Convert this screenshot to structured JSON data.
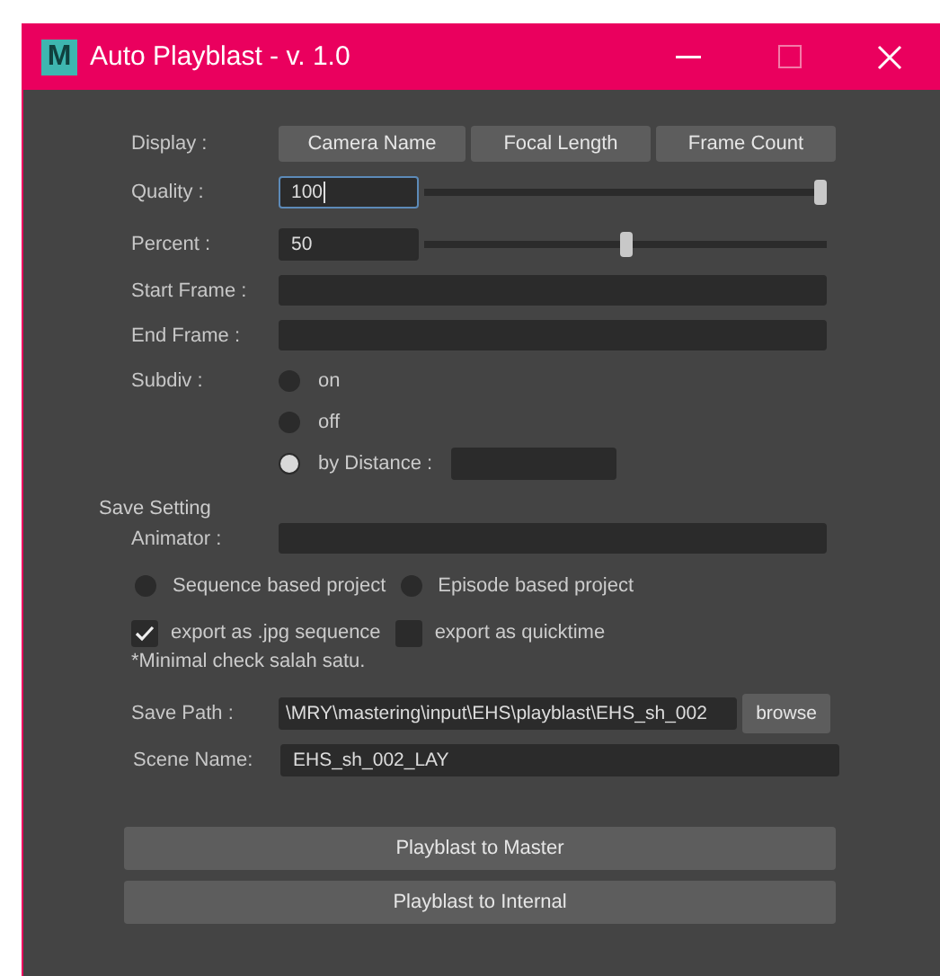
{
  "window": {
    "title": "Auto Playblast - v. 1.0",
    "logo": "M"
  },
  "display": {
    "label": "Display :",
    "buttons": [
      "Camera Name",
      "Focal Length",
      "Frame Count"
    ]
  },
  "sliders": [
    {
      "label": "Quality :",
      "value": "100",
      "focused": true,
      "level": 1.0
    },
    {
      "label": "Percent :",
      "value": "50",
      "focused": false,
      "level": 0.5
    }
  ],
  "frames": [
    {
      "label": "Start Frame :"
    },
    {
      "label": "End Frame :"
    }
  ],
  "subdiv": {
    "label": "Subdiv :",
    "options": [
      {
        "label": "on",
        "selected": false,
        "has_field": false
      },
      {
        "label": "off",
        "selected": false,
        "has_field": false
      },
      {
        "label": "by Distance :",
        "selected": true,
        "has_field": true
      }
    ]
  },
  "save_setting": {
    "heading": "Save Setting",
    "animator_label": "Animator :",
    "project_types": [
      {
        "label": "Sequence based project",
        "selected": false
      },
      {
        "label": "Episode based project",
        "selected": false
      }
    ],
    "exports": [
      {
        "label": "export as .jpg sequence",
        "checked": true
      },
      {
        "label": "export as quicktime",
        "checked": false
      }
    ],
    "note": "*Minimal check salah satu.",
    "save_path": {
      "label": "Save Path :",
      "value": "\\MRY\\mastering\\input\\EHS\\playblast\\EHS_sh_002",
      "button": "browse"
    },
    "scene_name": {
      "label": "Scene Name:",
      "value": "EHS_sh_002_LAY"
    }
  },
  "actions": [
    "Playblast to Master",
    "Playblast to Internal"
  ]
}
